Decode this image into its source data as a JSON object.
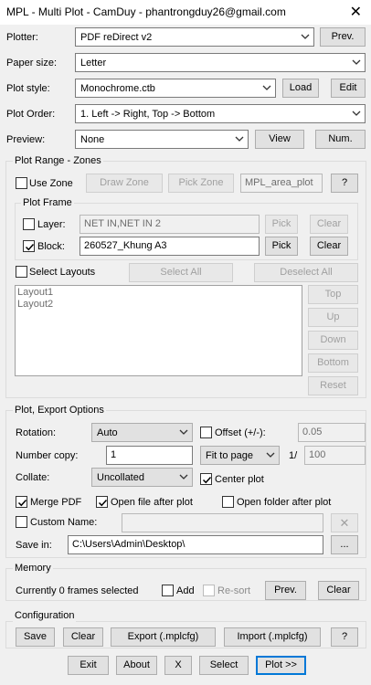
{
  "window": {
    "title": "MPL - Multi Plot - CamDuy - phantrongduy26@gmail.com",
    "close_glyph": "✕"
  },
  "top": {
    "plotter": {
      "label": "Plotter:",
      "value": "PDF reDirect v2",
      "button": "Prev."
    },
    "paper_size": {
      "label": "Paper size:",
      "value": "Letter"
    },
    "plot_style": {
      "label": "Plot style:",
      "value": "Monochrome.ctb",
      "load": "Load",
      "edit": "Edit"
    },
    "plot_order": {
      "label": "Plot Order:",
      "value": "1. Left -> Right, Top -> Bottom"
    },
    "preview": {
      "label": "Preview:",
      "value": "None",
      "view": "View",
      "num": "Num."
    }
  },
  "plot_range": {
    "title": "Plot Range - Zones",
    "use_zone": {
      "label": "Use Zone",
      "checked": false
    },
    "draw_zone": "Draw Zone",
    "pick_zone": "Pick Zone",
    "zone_field": "MPL_area_plot",
    "help": "?",
    "plot_frame": {
      "title": "Plot Frame",
      "layer": {
        "label": "Layer:",
        "checked": false,
        "value": "NET IN,NET IN 2",
        "pick": "Pick",
        "clear": "Clear"
      },
      "block": {
        "label": "Block:",
        "checked": true,
        "value": "260527_Khung A3",
        "pick": "Pick",
        "clear": "Clear"
      }
    },
    "select_layouts": {
      "label": "Select Layouts",
      "checked": false
    },
    "select_all": "Select All",
    "deselect_all": "Deselect All",
    "layouts": [
      "Layout1",
      "Layout2"
    ],
    "side_buttons": [
      "Top",
      "Up",
      "Down",
      "Bottom",
      "Reset"
    ]
  },
  "export": {
    "title": "Plot, Export Options",
    "rotation": {
      "label": "Rotation:",
      "value": "Auto"
    },
    "offset": {
      "label": "Offset (+/-):",
      "checked": false,
      "value": "0.05"
    },
    "number_copy": {
      "label": "Number copy:",
      "value": "1"
    },
    "fit": {
      "value": "Fit to page",
      "separator": "1/",
      "scale": "100"
    },
    "collate": {
      "label": "Collate:",
      "value": "Uncollated"
    },
    "center_plot": {
      "label": "Center plot",
      "checked": true
    },
    "merge_pdf": {
      "label": "Merge PDF",
      "checked": true
    },
    "open_file": {
      "label": "Open file after plot",
      "checked": true
    },
    "open_folder": {
      "label": "Open folder after plot",
      "checked": false
    },
    "custom_name": {
      "label": "Custom Name:",
      "checked": false,
      "clear_glyph": "✕"
    },
    "save_in": {
      "label": "Save in:",
      "value": "C:\\Users\\Admin\\Desktop\\",
      "browse": "..."
    }
  },
  "memory": {
    "title": "Memory",
    "status": "Currently 0 frames selected",
    "add": {
      "label": "Add",
      "checked": false
    },
    "resort": {
      "label": "Re-sort",
      "checked": false
    },
    "prev": "Prev.",
    "clear": "Clear"
  },
  "configuration": {
    "title": "Configuration",
    "save": "Save",
    "clear": "Clear",
    "export": "Export (.mplcfg)",
    "import": "Import (.mplcfg)",
    "help": "?"
  },
  "footer": {
    "exit": "Exit",
    "about": "About",
    "x": "X",
    "select": "Select",
    "plot": "Plot >>"
  }
}
